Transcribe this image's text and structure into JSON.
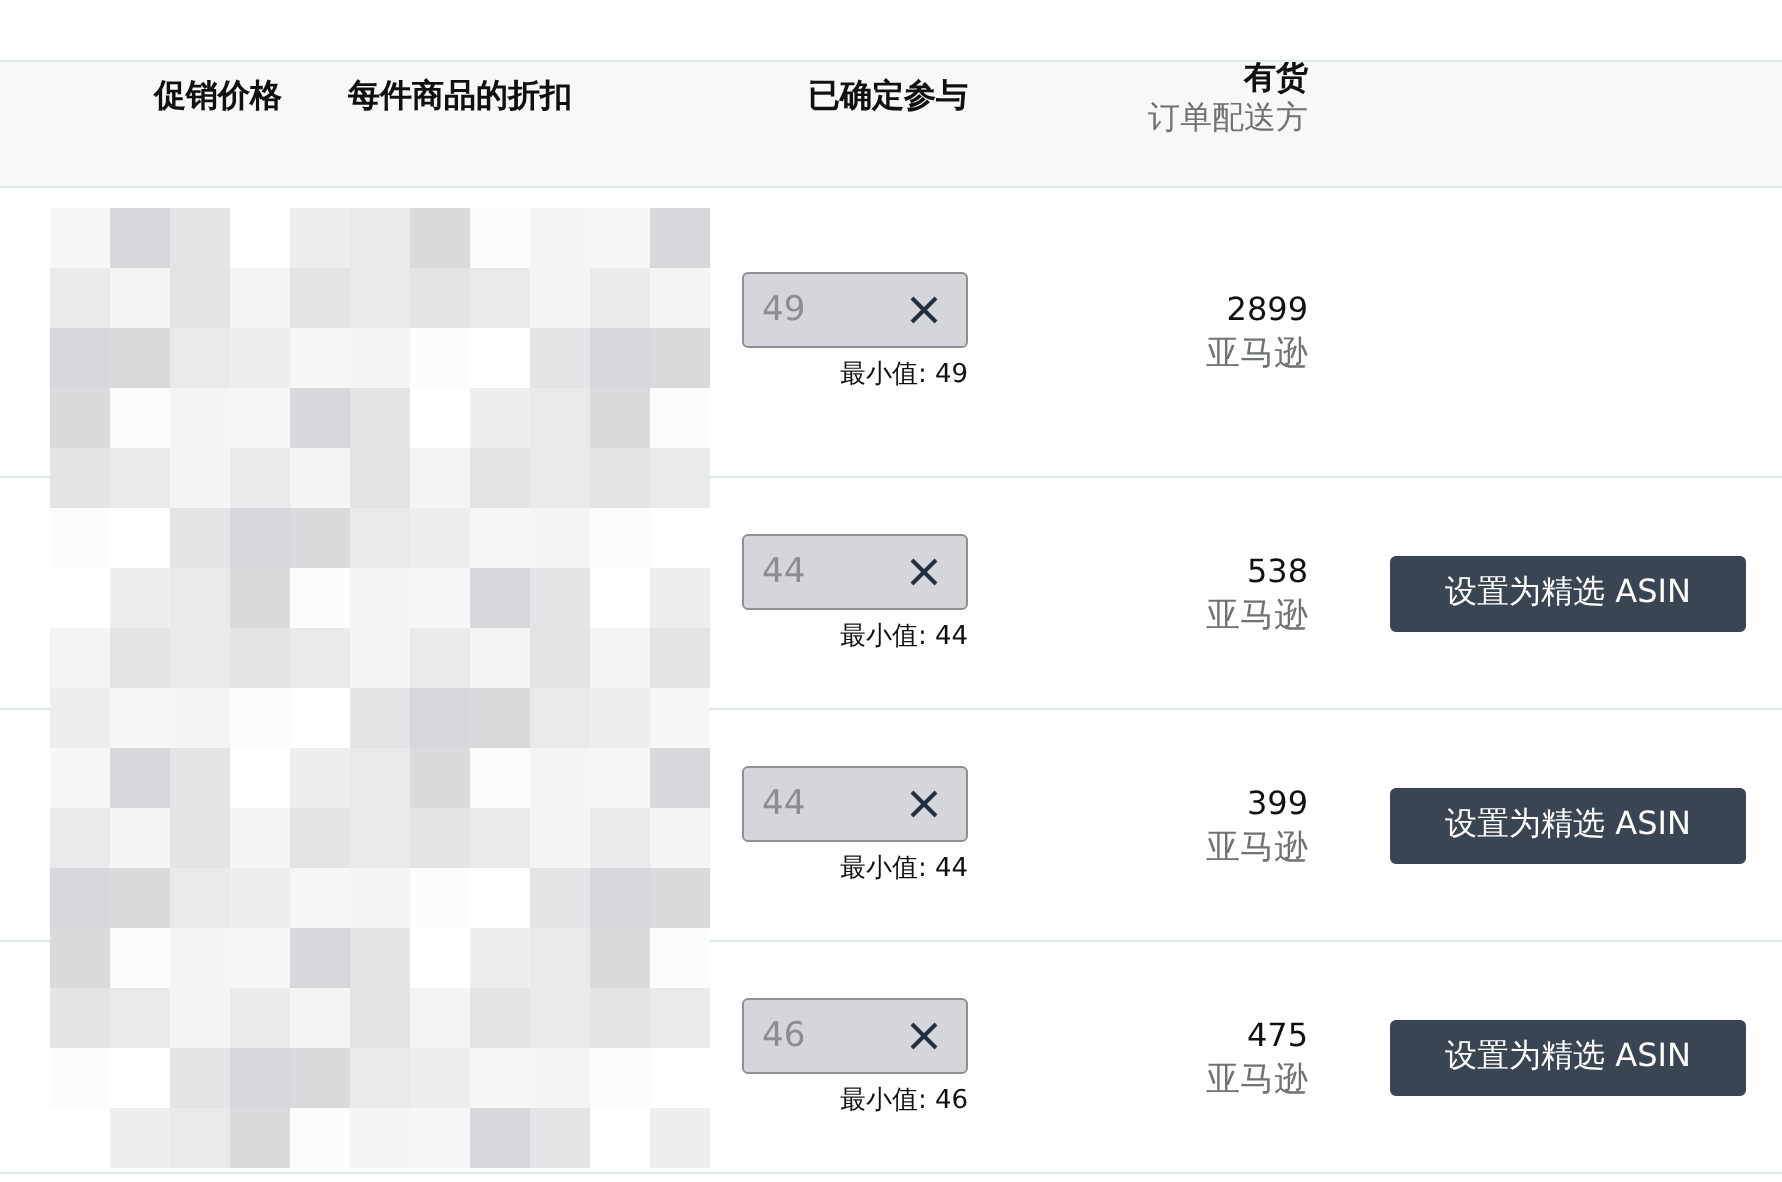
{
  "header": {
    "columns": [
      {
        "lines": [
          "促销价格"
        ]
      },
      {
        "lines": [
          "每件商品的折扣"
        ]
      },
      {
        "lines": [
          "已确定参与"
        ]
      },
      {
        "lines": [
          "有货",
          "订单配送方"
        ]
      }
    ]
  },
  "rows": [
    {
      "placeholder": "49",
      "min_label": "最小值: 49",
      "quantity": "2899",
      "fulfiller": "亚马逊"
    },
    {
      "placeholder": "44",
      "min_label": "最小值: 44",
      "quantity": "538",
      "fulfiller": "亚马逊",
      "button": "设置为精选 ASIN"
    },
    {
      "placeholder": "44",
      "min_label": "最小值: 44",
      "quantity": "399",
      "fulfiller": "亚马逊",
      "button": "设置为精选 ASIN"
    },
    {
      "placeholder": "46",
      "min_label": "最小值: 46",
      "quantity": "475",
      "fulfiller": "亚马逊",
      "button": "设置为精选 ASIN"
    }
  ]
}
